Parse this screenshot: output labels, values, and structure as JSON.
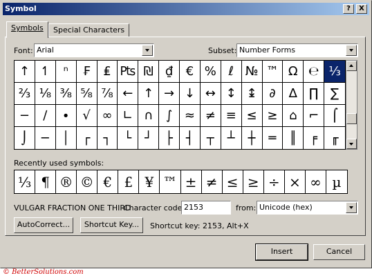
{
  "dialog": {
    "title": "Symbol"
  },
  "titlebar_buttons": {
    "help": "?",
    "close": "X"
  },
  "tabs": [
    {
      "label": "Symbols",
      "active": true
    },
    {
      "label": "Special Characters",
      "active": false
    }
  ],
  "font": {
    "label": "Font:",
    "value": "Arial"
  },
  "subset": {
    "label": "Subset:",
    "value": "Number Forms"
  },
  "symbol_grid": {
    "selected": "⅓",
    "rows": [
      [
        "↑",
        "↿",
        "ⁿ",
        "₣",
        "₤",
        "₧",
        "₪",
        "₫",
        "€",
        "%",
        "ℓ",
        "№",
        "™",
        "Ω",
        "℮",
        "⅓"
      ],
      [
        "⅔",
        "⅛",
        "⅜",
        "⅝",
        "⅞",
        "←",
        "↑",
        "→",
        "↓",
        "↔",
        "↕",
        "↨",
        "∂",
        "∆",
        "∏",
        "∑"
      ],
      [
        "−",
        "∕",
        "∙",
        "√",
        "∞",
        "∟",
        "∩",
        "∫",
        "≈",
        "≠",
        "≡",
        "≤",
        "≥",
        "⌂",
        "⌐",
        "⌠"
      ],
      [
        "⌡",
        "─",
        "│",
        "┌",
        "┐",
        "└",
        "┘",
        "├",
        "┤",
        "┬",
        "┴",
        "┼",
        "═",
        "║",
        "╒",
        "╓"
      ]
    ]
  },
  "recent": {
    "label": "Recently used symbols:",
    "symbols": [
      "⅓",
      "¶",
      "®",
      "©",
      "€",
      "£",
      "¥",
      "™",
      "±",
      "≠",
      "≤",
      "≥",
      "÷",
      "×",
      "∞",
      "µ"
    ]
  },
  "char_name": "VULGAR FRACTION ONE THIRD",
  "char_code": {
    "label": "Character code:",
    "value": "2153"
  },
  "from": {
    "label": "from:",
    "value": "Unicode (hex)"
  },
  "buttons": {
    "autocorrect": "AutoCorrect...",
    "shortcut_key": "Shortcut Key...",
    "insert": "Insert",
    "cancel": "Cancel"
  },
  "shortcut_info": "Shortcut key: 2153, Alt+X",
  "copyright": "© BetterSolutions.com"
}
